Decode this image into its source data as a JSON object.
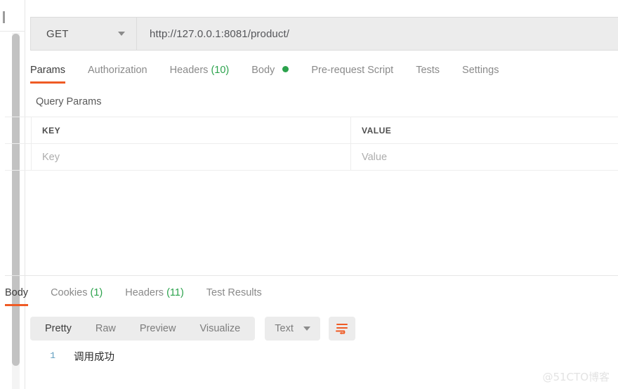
{
  "request": {
    "method": "GET",
    "url": "http://127.0.0.1:8081/product/",
    "tabs": [
      {
        "label": "Params",
        "count": null,
        "dot": false,
        "active": true
      },
      {
        "label": "Authorization",
        "count": null,
        "dot": false,
        "active": false
      },
      {
        "label": "Headers",
        "count": "(10)",
        "dot": false,
        "active": false
      },
      {
        "label": "Body",
        "count": null,
        "dot": true,
        "active": false
      },
      {
        "label": "Pre-request Script",
        "count": null,
        "dot": false,
        "active": false
      },
      {
        "label": "Tests",
        "count": null,
        "dot": false,
        "active": false
      },
      {
        "label": "Settings",
        "count": null,
        "dot": false,
        "active": false
      }
    ],
    "query_params": {
      "section_title": "Query Params",
      "columns": [
        "KEY",
        "VALUE"
      ],
      "rows": [
        {
          "key_placeholder": "Key",
          "value_placeholder": "Value"
        }
      ]
    }
  },
  "response": {
    "tabs": [
      {
        "label": "Body",
        "count": null,
        "active": true
      },
      {
        "label": "Cookies",
        "count": "(1)",
        "active": false
      },
      {
        "label": "Headers",
        "count": "(11)",
        "active": false
      },
      {
        "label": "Test Results",
        "count": null,
        "active": false
      }
    ],
    "view_modes": [
      {
        "label": "Pretty",
        "active": true
      },
      {
        "label": "Raw",
        "active": false
      },
      {
        "label": "Preview",
        "active": false
      },
      {
        "label": "Visualize",
        "active": false
      }
    ],
    "format": "Text",
    "wrap_icon": "word-wrap-icon",
    "body": {
      "line_number": "1",
      "content": "调用成功"
    }
  },
  "watermark": "@51CTO博客",
  "colors": {
    "accent": "#ef5b25",
    "count_green": "#2ba24c",
    "panel_bg": "#ececec",
    "border": "#dcdcdc"
  }
}
